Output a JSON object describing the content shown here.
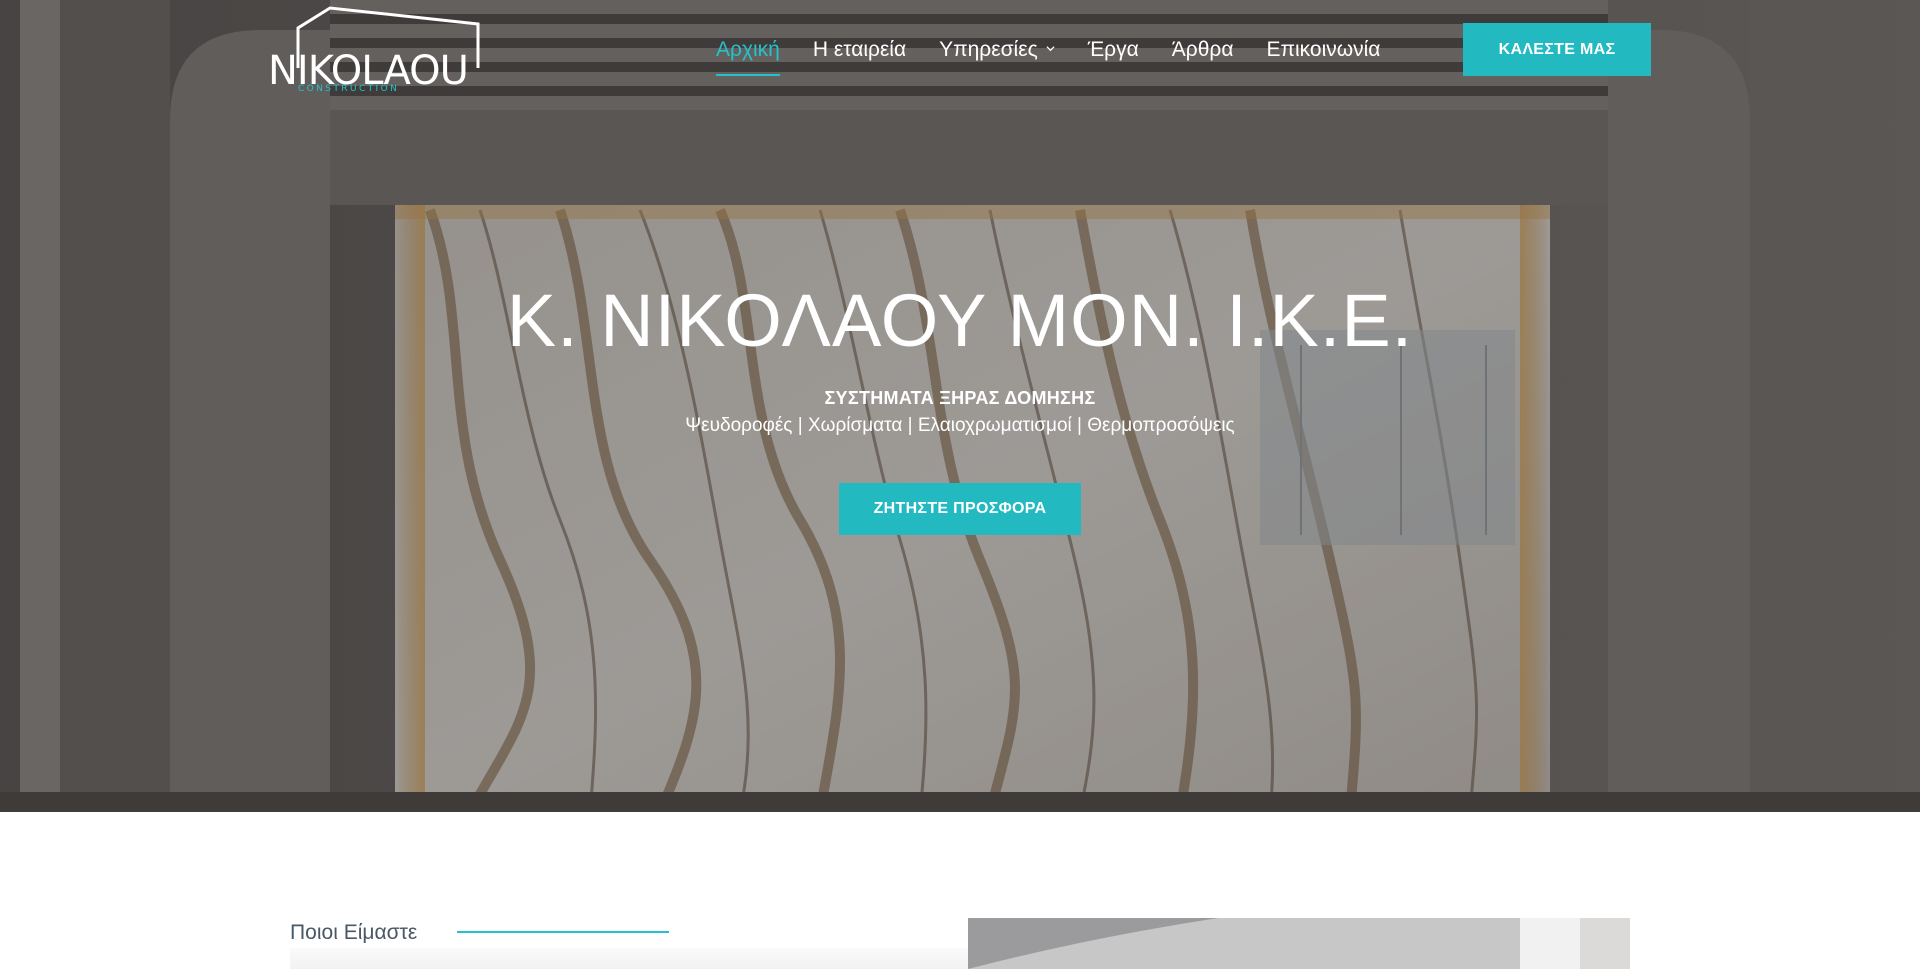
{
  "brand": {
    "logo_text": "NIKOLAOU",
    "logo_subtext": "CONSTRUCTION"
  },
  "nav": {
    "items": [
      {
        "label": "Αρχική",
        "active": true
      },
      {
        "label": "Η εταιρεία",
        "active": false
      },
      {
        "label": "Υπηρεσίες",
        "active": false,
        "has_dropdown": true
      },
      {
        "label": "Έργα",
        "active": false
      },
      {
        "label": "Άρθρα",
        "active": false
      },
      {
        "label": "Επικοινωνία",
        "active": false
      }
    ],
    "call_label": "ΚΑΛΕΣΤΕ ΜΑΣ"
  },
  "hero": {
    "title": "Κ. ΝΙΚΟΛΑΟΥ ΜΟΝ. Ι.Κ.Ε.",
    "subtitle": "ΣΥΣΤΗΜΑΤΑ ΞΗΡΑΣ ΔΟΜΗΣΗΣ",
    "services_line": "Ψευδοροφές | Χωρίσματα | Ελαιοχρωματισμοί | Θερμοπροσόψεις",
    "cta_label": "ΖΗΤΗΣΤΕ ΠΡΟΣΦΟΡΑ"
  },
  "about": {
    "label": "Ποιοι Είμαστε"
  },
  "colors": {
    "accent": "#22b9c1",
    "accent_text": "#22c3cc",
    "heading_gray": "#4a5866"
  },
  "icons": {
    "dropdown": "chevron-down-icon"
  }
}
